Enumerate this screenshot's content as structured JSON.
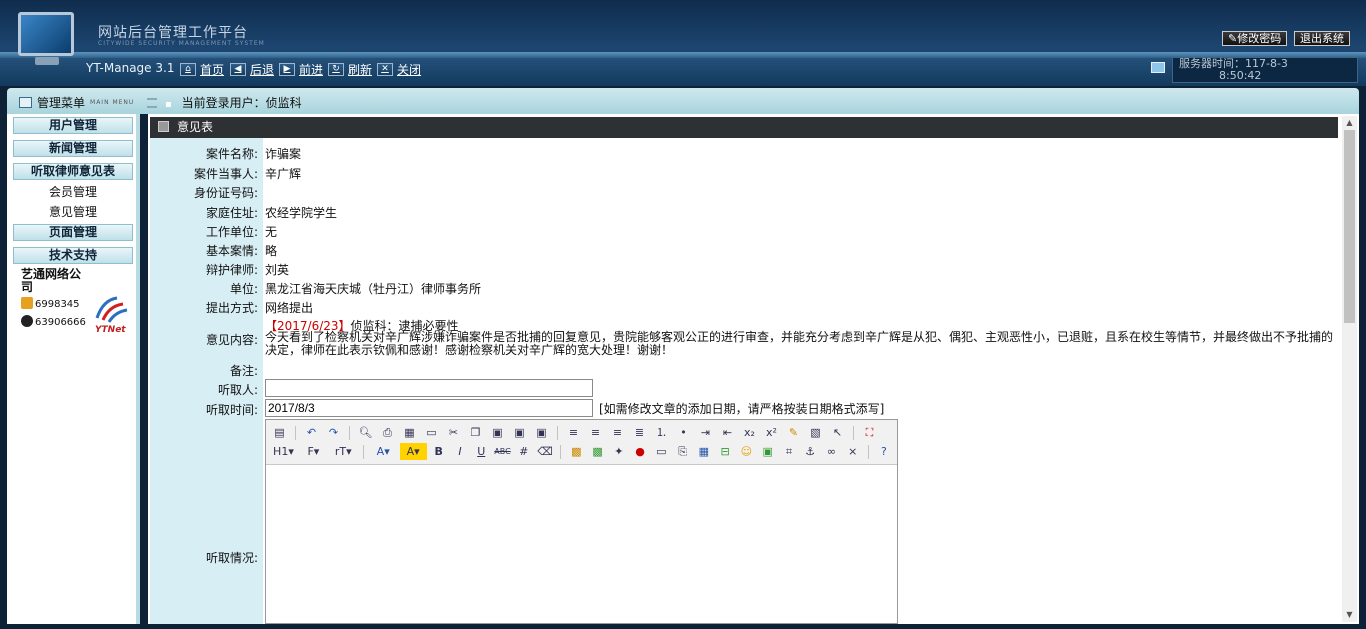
{
  "header": {
    "title": "网站后台管理工作平台",
    "subtitle": "CITYWIDE SECURITY MANAGEMENT SYSTEM",
    "version": "YT-Manage 3.1",
    "nav": [
      {
        "label": "首页",
        "icon": "home-icon"
      },
      {
        "label": "后退",
        "icon": "back-arrow-icon"
      },
      {
        "label": "前进",
        "icon": "forward-arrow-icon"
      },
      {
        "label": "刷新",
        "icon": "refresh-icon"
      },
      {
        "label": "关闭",
        "icon": "close-icon"
      }
    ],
    "change_password": "修改密码",
    "logout": "退出系统",
    "server_time_label": "服务器时间：",
    "server_time_date": "117-8-3",
    "server_time_clock": "8:50:42"
  },
  "subbar": {
    "menu_title": "管理菜单",
    "menu_title_en": "MAIN MENU",
    "current_user_label": "当前登录用户：",
    "current_user": "侦监科"
  },
  "sidebar": {
    "groups": [
      {
        "label": "用户管理"
      },
      {
        "label": "新闻管理"
      },
      {
        "label": "听取律师意见表",
        "items": [
          "会员管理",
          "意见管理"
        ]
      },
      {
        "label": "页面管理"
      },
      {
        "label": "技术支持"
      }
    ],
    "company": "艺通网络公司",
    "phone": "6998345",
    "qq": "63906666",
    "logo_text": "YTNet"
  },
  "panel": {
    "title": "意见表",
    "fields": [
      {
        "label": "案件名称:",
        "value": "诈骗案"
      },
      {
        "label": "案件当事人:",
        "value": "辛广辉"
      },
      {
        "label": "身份证号码:",
        "value": ""
      },
      {
        "label": "家庭住址:",
        "value": "农经学院学生"
      },
      {
        "label": "工作单位:",
        "value": "无"
      },
      {
        "label": "基本案情:",
        "value": "略"
      },
      {
        "label": "辩护律师:",
        "value": "刘英"
      },
      {
        "label": "单位:",
        "value": "黑龙江省海天庆城（牡丹江）律师事务所"
      },
      {
        "label": "提出方式:",
        "value": "网络提出"
      }
    ],
    "opinion_label": "意见内容:",
    "opinion_date": "【2017/6/23】",
    "opinion_author": "侦监科：逮捕必要性",
    "opinion_text": "今天看到了检察机关对辛广辉涉嫌诈骗案件是否批捕的回复意见，贵院能够客观公正的进行审查，并能充分考虑到辛广辉是从犯、偶犯、主观恶性小，已退赃，且系在校生等情节，并最终做出不予批捕的决定，律师在此表示钦佩和感谢！感谢检察机关对辛广辉的宽大处理！谢谢！",
    "remark_label": "备注:",
    "receiver_label": "听取人:",
    "receiver_value": "",
    "time_label": "听取时间:",
    "time_value": "2017/8/3",
    "time_hint": "[如需修改文章的添加日期，请严格按装日期格式添写]",
    "situation_label": "听取情况:"
  },
  "editor": {
    "toolbar_row1": [
      "source-icon",
      "undo-icon",
      "redo-icon",
      "|",
      "preview-icon",
      "print-icon",
      "template-icon",
      "code-icon",
      "cut-icon",
      "copy-icon",
      "paste-icon",
      "paste-text-icon",
      "paste-word-icon",
      "|",
      "align-left-icon",
      "align-center-icon",
      "align-right-icon",
      "justify-icon",
      "ordered-list-icon",
      "unordered-list-icon",
      "indent-icon",
      "outdent-icon",
      "subscript-icon",
      "superscript-icon",
      "clear-format-icon",
      "select-all-icon",
      "cursor-icon",
      "|",
      "fullscreen-icon"
    ],
    "toolbar_row2_text": [
      "H1",
      "F",
      "rT",
      "A",
      "A",
      "B",
      "I",
      "U",
      "ABC"
    ]
  },
  "colors": {
    "header_dark": "#0f2c4c",
    "label_bg": "#d8eef5",
    "panel_head": "#2e3134",
    "accent_red": "#cc0000"
  }
}
